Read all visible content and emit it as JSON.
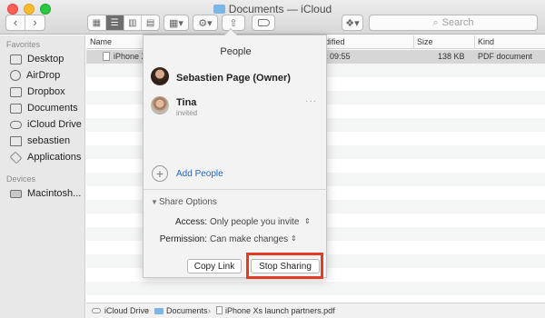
{
  "window": {
    "title": "Documents — iCloud"
  },
  "toolbar": {
    "nav_back": "‹",
    "nav_forward": "›",
    "view_icons": [
      "▦",
      "☰",
      "▥",
      "▤"
    ],
    "arrange_icon": "▦▾",
    "gear_icon": "⚙▾",
    "share_icon": "⇧",
    "dropbox_icon": "❖▾",
    "search_placeholder": "Search"
  },
  "sidebar": {
    "favorites_heading": "Favorites",
    "favorites": [
      "Desktop",
      "AirDrop",
      "Dropbox",
      "Documents",
      "iCloud Drive",
      "sebastien",
      "Applications"
    ],
    "devices_heading": "Devices",
    "devices": [
      "Macintosh..."
    ]
  },
  "columns": {
    "name": "Name",
    "modified": "odified",
    "size": "Size",
    "kind": "Kind"
  },
  "files": [
    {
      "name": "iPhone X",
      "modified": "at 09:55",
      "size": "138 KB",
      "kind": "PDF document"
    }
  ],
  "popover": {
    "title": "People",
    "owner_name": "Sebastien Page (Owner)",
    "invitee_name": "Tina",
    "invitee_status": "invited",
    "more_icon": "···",
    "add_people_label": "Add People",
    "share_options_label": "Share Options",
    "access_label": "Access:",
    "access_value": "Only people you invite",
    "permission_label": "Permission:",
    "permission_value": "Can make changes",
    "copy_link_label": "Copy Link",
    "stop_sharing_label": "Stop Sharing"
  },
  "pathbar": {
    "items": [
      "iCloud Drive",
      "Documents",
      "iPhone Xs launch partners.pdf"
    ]
  },
  "colors": {
    "highlight": "#e03c26",
    "link": "#1f66c5",
    "folder": "#7cb6e8"
  }
}
